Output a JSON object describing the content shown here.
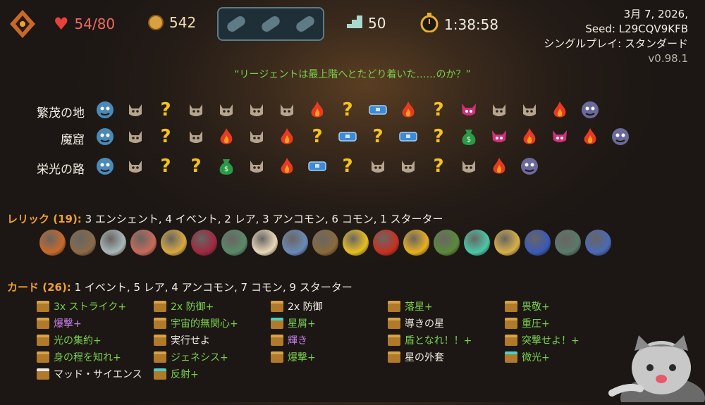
{
  "top": {
    "hp": "54/80",
    "gold": "542",
    "floor": "50",
    "time": "1:38:58"
  },
  "meta": {
    "date": "3月 7, 2026,",
    "seed": "Seed: L29CQV9KFB",
    "mode": "シングルプレイ: スタンダード",
    "version": "v0.98.1"
  },
  "quote": "“リージェントは最上階へとたどり着いた……のか？”",
  "acts": [
    {
      "name": "繁茂の地",
      "nodes": [
        "boss-prev",
        "monster",
        "unknown",
        "monster",
        "monster",
        "monster",
        "monster",
        "rest",
        "unknown",
        "treasure",
        "rest",
        "unknown",
        "elite",
        "monster",
        "monster",
        "rest",
        "boss"
      ]
    },
    {
      "name": "魔窟",
      "nodes": [
        "boss-prev",
        "monster",
        "unknown",
        "monster",
        "rest",
        "monster",
        "rest",
        "unknown",
        "treasure",
        "unknown",
        "treasure",
        "unknown",
        "shop",
        "elite",
        "rest",
        "elite",
        "rest",
        "boss"
      ]
    },
    {
      "name": "栄光の路",
      "nodes": [
        "boss-prev",
        "monster",
        "unknown",
        "unknown",
        "shop",
        "monster",
        "rest",
        "treasure",
        "unknown",
        "monster",
        "monster",
        "unknown",
        "monster",
        "rest",
        "boss"
      ]
    }
  ],
  "relics_header": {
    "label": "レリック (19):",
    "summary": "3 エンシェント, 4 イベント, 2 レア, 3 アンコモン, 6 コモン, 1 スターター"
  },
  "relics": [
    "ember-icon",
    "scroll-icon",
    "stone-icon",
    "meat-icon",
    "compass-icon",
    "potion-icon",
    "teapot-icon",
    "cake-icon",
    "can-icon",
    "log-icon",
    "banana-icon",
    "flask-icon",
    "coin-icon",
    "fern-icon",
    "bracket-icon",
    "mushroom-icon",
    "feather-icon",
    "kettle-icon",
    "anvil-icon"
  ],
  "cards_header": {
    "label": "カード (26):",
    "summary": "1 イベント, 5 レア, 4 アンコモン, 7 コモン, 9 スターター"
  },
  "cards": [
    {
      "name": "3x ストライク+",
      "color": "green",
      "icon": "card-icon"
    },
    {
      "name": "2x 防御+",
      "color": "green",
      "icon": "card-icon"
    },
    {
      "name": "2x 防御",
      "color": "white",
      "icon": "card-icon"
    },
    {
      "name": "落星+",
      "color": "green",
      "icon": "card-icon"
    },
    {
      "name": "畏敬+",
      "color": "green",
      "icon": "card-icon"
    },
    {
      "name": "爆撃+",
      "color": "purple",
      "icon": "card-icon"
    },
    {
      "name": "宇宙的無関心+",
      "color": "green",
      "icon": "card-icon"
    },
    {
      "name": "星屑+",
      "color": "green",
      "icon": "card-icon"
    },
    {
      "name": "導きの星",
      "color": "white",
      "icon": "card-icon"
    },
    {
      "name": "重圧+",
      "color": "green",
      "icon": "card-icon"
    },
    {
      "name": "光の集約+",
      "color": "green",
      "icon": "card-icon"
    },
    {
      "name": "実行せよ",
      "color": "white",
      "icon": "card-icon"
    },
    {
      "name": "輝き",
      "color": "purple",
      "icon": "card-icon"
    },
    {
      "name": "盾となれ！！+",
      "color": "green",
      "icon": "card-icon"
    },
    {
      "name": "突撃せよ！+",
      "color": "green",
      "icon": "card-icon"
    },
    {
      "name": "身の程を知れ+",
      "color": "green",
      "icon": "card-icon"
    },
    {
      "name": "ジェネシス+",
      "color": "green",
      "icon": "card-icon"
    },
    {
      "name": "爆撃+",
      "color": "green",
      "icon": "card-icon"
    },
    {
      "name": "星の外套",
      "color": "white",
      "icon": "card-icon"
    },
    {
      "name": "微光+",
      "color": "green",
      "icon": "card-icon"
    },
    {
      "name": "マッド・サイエンス",
      "color": "white",
      "icon": "card-icon"
    },
    {
      "name": "反射+",
      "color": "green",
      "icon": "card-icon"
    }
  ]
}
